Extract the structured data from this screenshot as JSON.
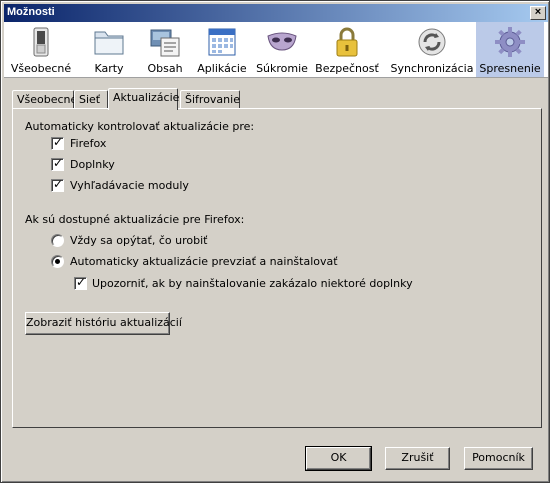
{
  "window": {
    "title": "Možnosti",
    "close_glyph": "×"
  },
  "toolbar": {
    "panes": [
      {
        "label": "Všeobecné",
        "icon": "switch-icon"
      },
      {
        "label": "Karty",
        "icon": "tabs-folder-icon"
      },
      {
        "label": "Obsah",
        "icon": "content-page-icon"
      },
      {
        "label": "Aplikácie",
        "icon": "applications-calendar-icon"
      },
      {
        "label": "Súkromie",
        "icon": "privacy-mask-icon"
      },
      {
        "label": "Bezpečnosť",
        "icon": "padlock-icon"
      },
      {
        "label": "Synchronizácia",
        "icon": "sync-icon"
      },
      {
        "label": "Spresnenie",
        "icon": "gear-icon",
        "selected": true
      }
    ]
  },
  "tabs": [
    {
      "label": "Všeobecné"
    },
    {
      "label": "Sieť"
    },
    {
      "label": "Aktualizácie",
      "active": true
    },
    {
      "label": "Šifrovanie"
    }
  ],
  "updates": {
    "auto_check_heading": "Automaticky kontrolovať aktualizácie pre:",
    "check_firefox": {
      "label": "Firefox",
      "checked": true
    },
    "check_addons": {
      "label": "Doplnky",
      "checked": true
    },
    "check_search": {
      "label": "Vyhľadávacie moduly",
      "checked": true
    },
    "available_heading": "Ak sú dostupné aktualizácie pre Firefox:",
    "radio_ask": {
      "label": "Vždy sa opýtať, čo urobiť",
      "selected": false
    },
    "radio_auto": {
      "label": "Automaticky aktualizácie prevziať a nainštalovať",
      "selected": true
    },
    "check_warn": {
      "label": "Upozorniť, ak by nainštalovanie zakázalo niektoré doplnky",
      "checked": true
    },
    "history_button": "Zobraziť históriu aktualizácií"
  },
  "buttons": {
    "ok": "OK",
    "cancel": "Zrušiť",
    "help": "Pomocník"
  },
  "colors": {
    "title_start": "#0a246a",
    "title_end": "#a6caf0",
    "selected_pane": "#bbcae8"
  }
}
